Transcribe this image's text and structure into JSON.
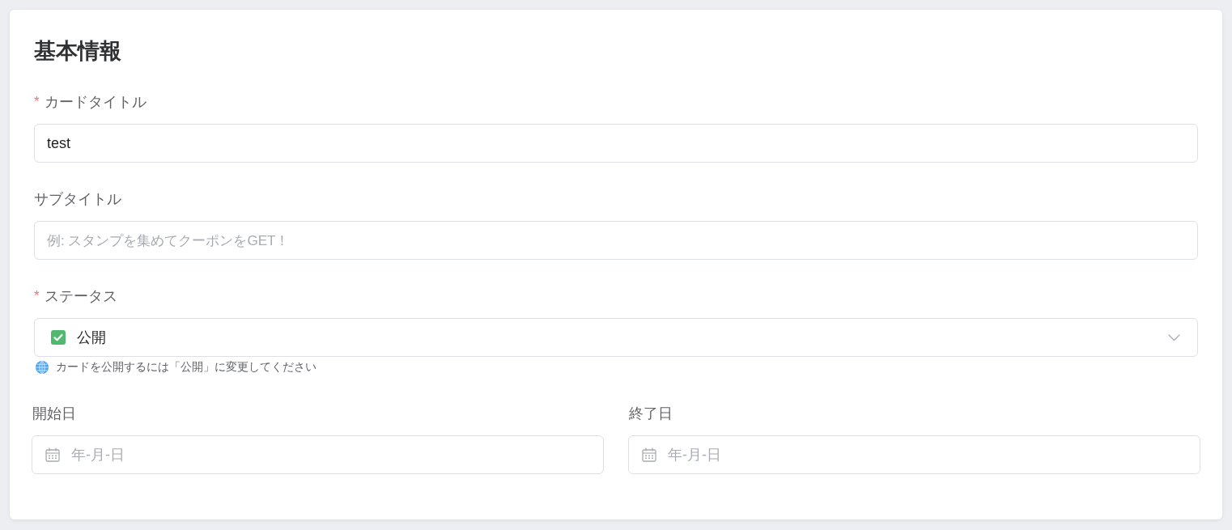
{
  "section": {
    "title": "基本情報"
  },
  "fields": [
    {
      "kind": "text",
      "required_mark": "*",
      "label": "カードタイトル",
      "value": "test"
    },
    {
      "kind": "text",
      "label": "サブタイトル",
      "placeholder": "例: スタンプを集めてクーポンをGET！"
    },
    {
      "kind": "select",
      "required_mark": "*",
      "label": "ステータス",
      "value": "公開",
      "hint": "カードを公開するには「公開」に変更してください"
    }
  ],
  "date_fields": [
    {
      "label": "開始日",
      "placeholder": "年-月-日"
    },
    {
      "label": "終了日",
      "placeholder": "年-月-日"
    }
  ]
}
